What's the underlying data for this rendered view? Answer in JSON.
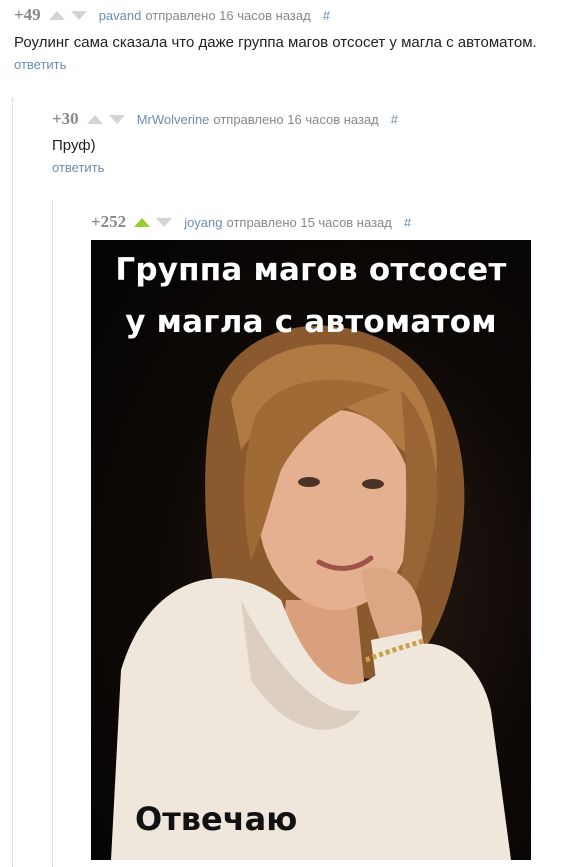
{
  "comments": [
    {
      "score": "+49",
      "author": "pavand",
      "sent": "отправлено 16 часов назад",
      "hash": "#",
      "text": "Роулинг сама сказала что даже группа магов отсосет у магла с автоматом.",
      "reply": "ответить"
    },
    {
      "score": "+30",
      "author": "MrWolverine",
      "sent": "отправлено 16 часов назад",
      "hash": "#",
      "text": "Пруф)",
      "reply": "ответить"
    },
    {
      "score": "+252",
      "author": "joyang",
      "sent": "отправлено 15 часов назад",
      "hash": "#",
      "upvoted": true
    }
  ],
  "meme": {
    "caption_line1": "Группа магов отсосет",
    "caption_line2": "у магла с автоматом",
    "bottom_text": "Отвечаю"
  },
  "colors": {
    "link": "#6a8db3",
    "score": "#888888",
    "upvote_active": "#9acd32",
    "arrow_inactive": "#d4d4d4"
  },
  "icons": [
    "upvote-arrow-icon",
    "downvote-arrow-icon"
  ]
}
